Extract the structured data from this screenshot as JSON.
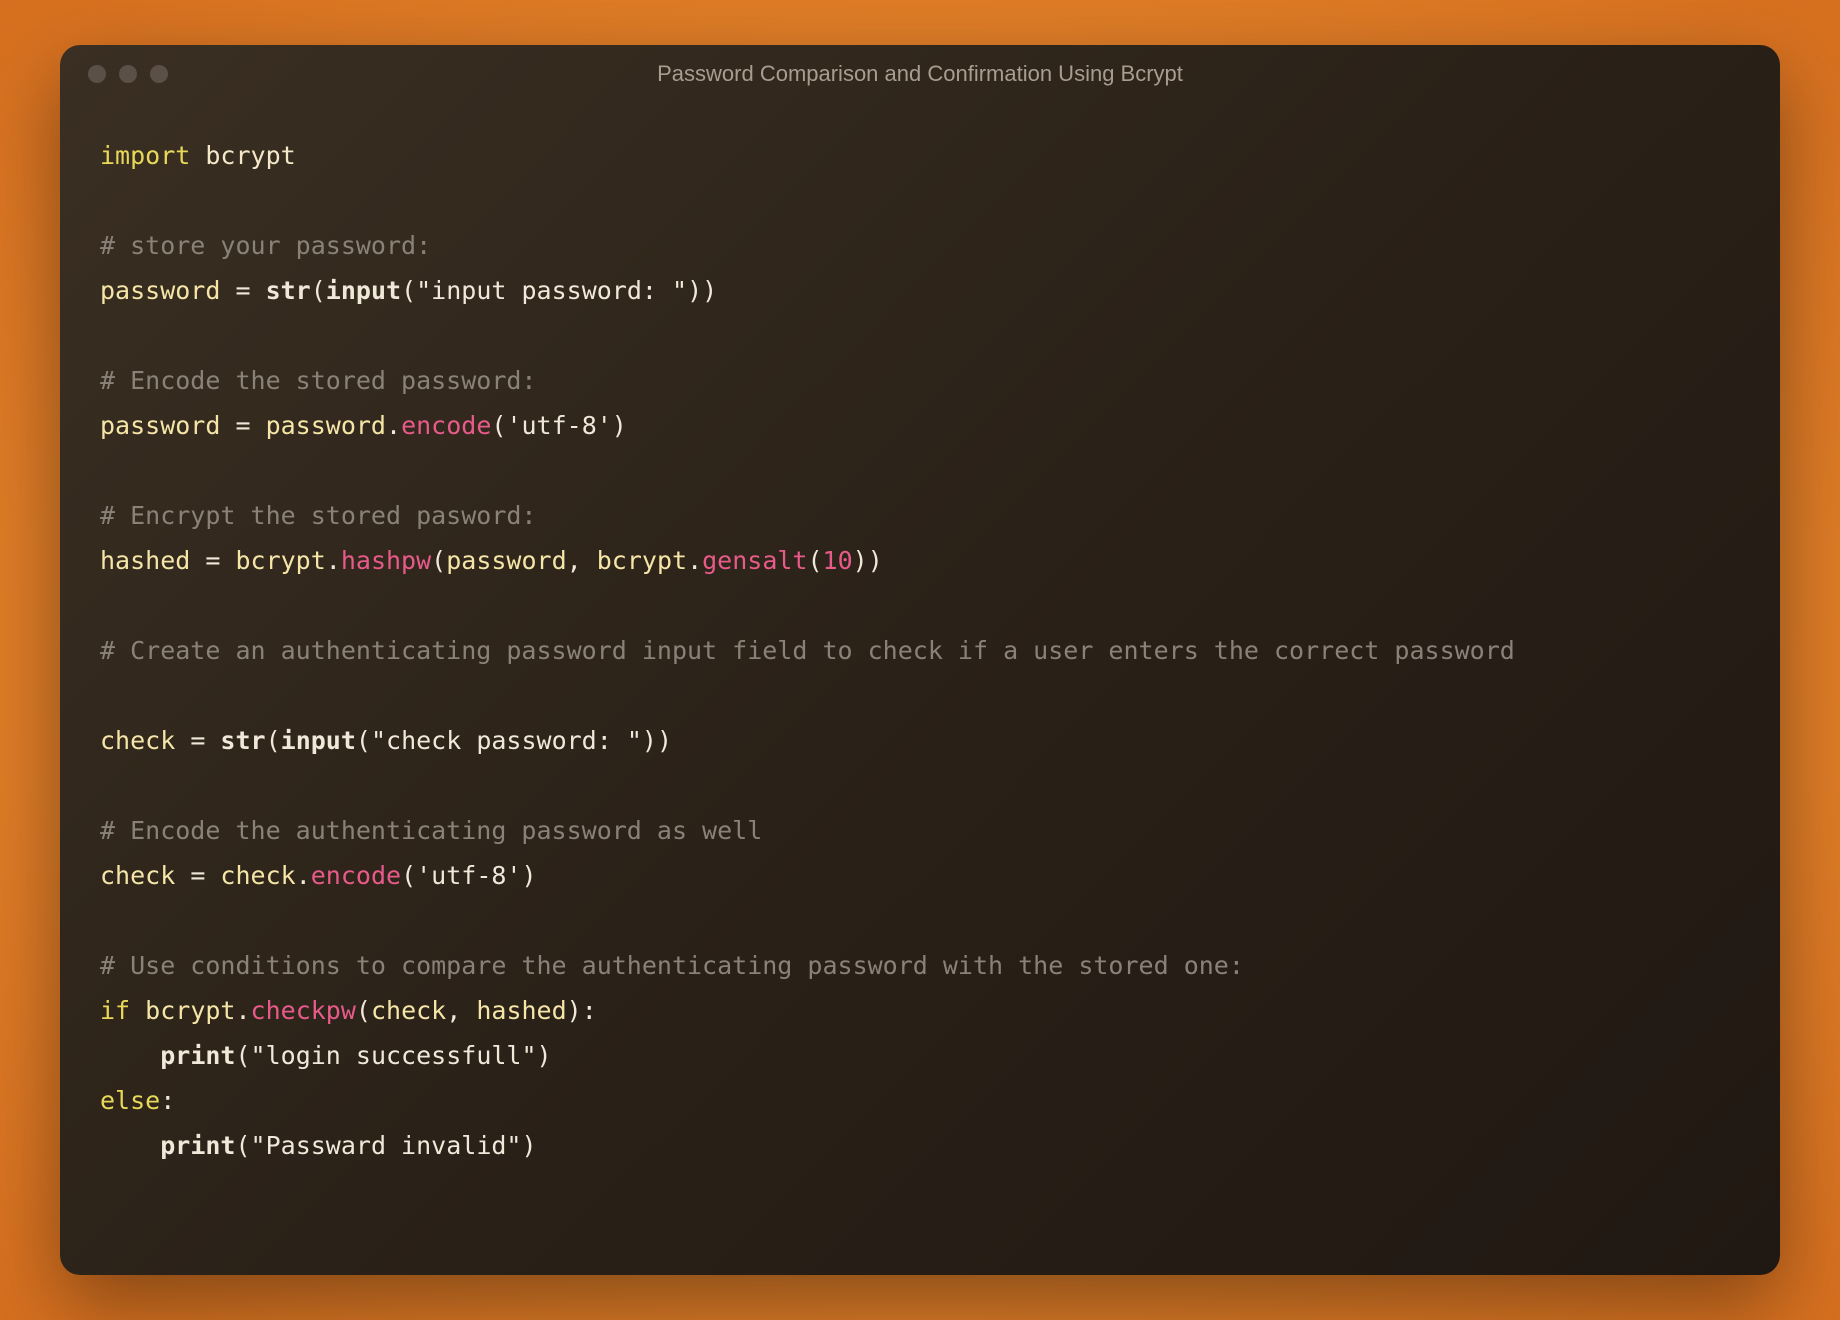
{
  "window": {
    "title": "Password Comparison and Confirmation Using Bcrypt"
  },
  "code": {
    "import_kw": "import",
    "module": "bcrypt",
    "comment1": "# store your password:",
    "var_password": "password",
    "eq": " = ",
    "builtin_str": "str",
    "builtin_input": "input",
    "str_input_password": "\"input password: \"",
    "comment2": "# Encode the stored password:",
    "method_encode": "encode",
    "str_utf8": "'utf-8'",
    "comment3": "# Encrypt the stored pasword:",
    "var_hashed": "hashed",
    "method_hashpw": "hashpw",
    "method_gensalt": "gensalt",
    "num_10": "10",
    "comment4": "# Create an authenticating password input field to check if a user enters the correct password",
    "var_check": "check",
    "str_check_password": "\"check password: \"",
    "comment5": "# Encode the authenticating password as well",
    "comment6": "# Use conditions to compare the authenticating password with the stored one:",
    "kw_if": "if",
    "method_checkpw": "checkpw",
    "builtin_print": "print",
    "str_login_success": "\"login successfull\"",
    "kw_else": "else",
    "str_password_invalid": "\"Passward invalid\"",
    "dot": ".",
    "comma": ", ",
    "colon": ":",
    "indent": "    ",
    "lparen": "(",
    "rparen": ")"
  }
}
